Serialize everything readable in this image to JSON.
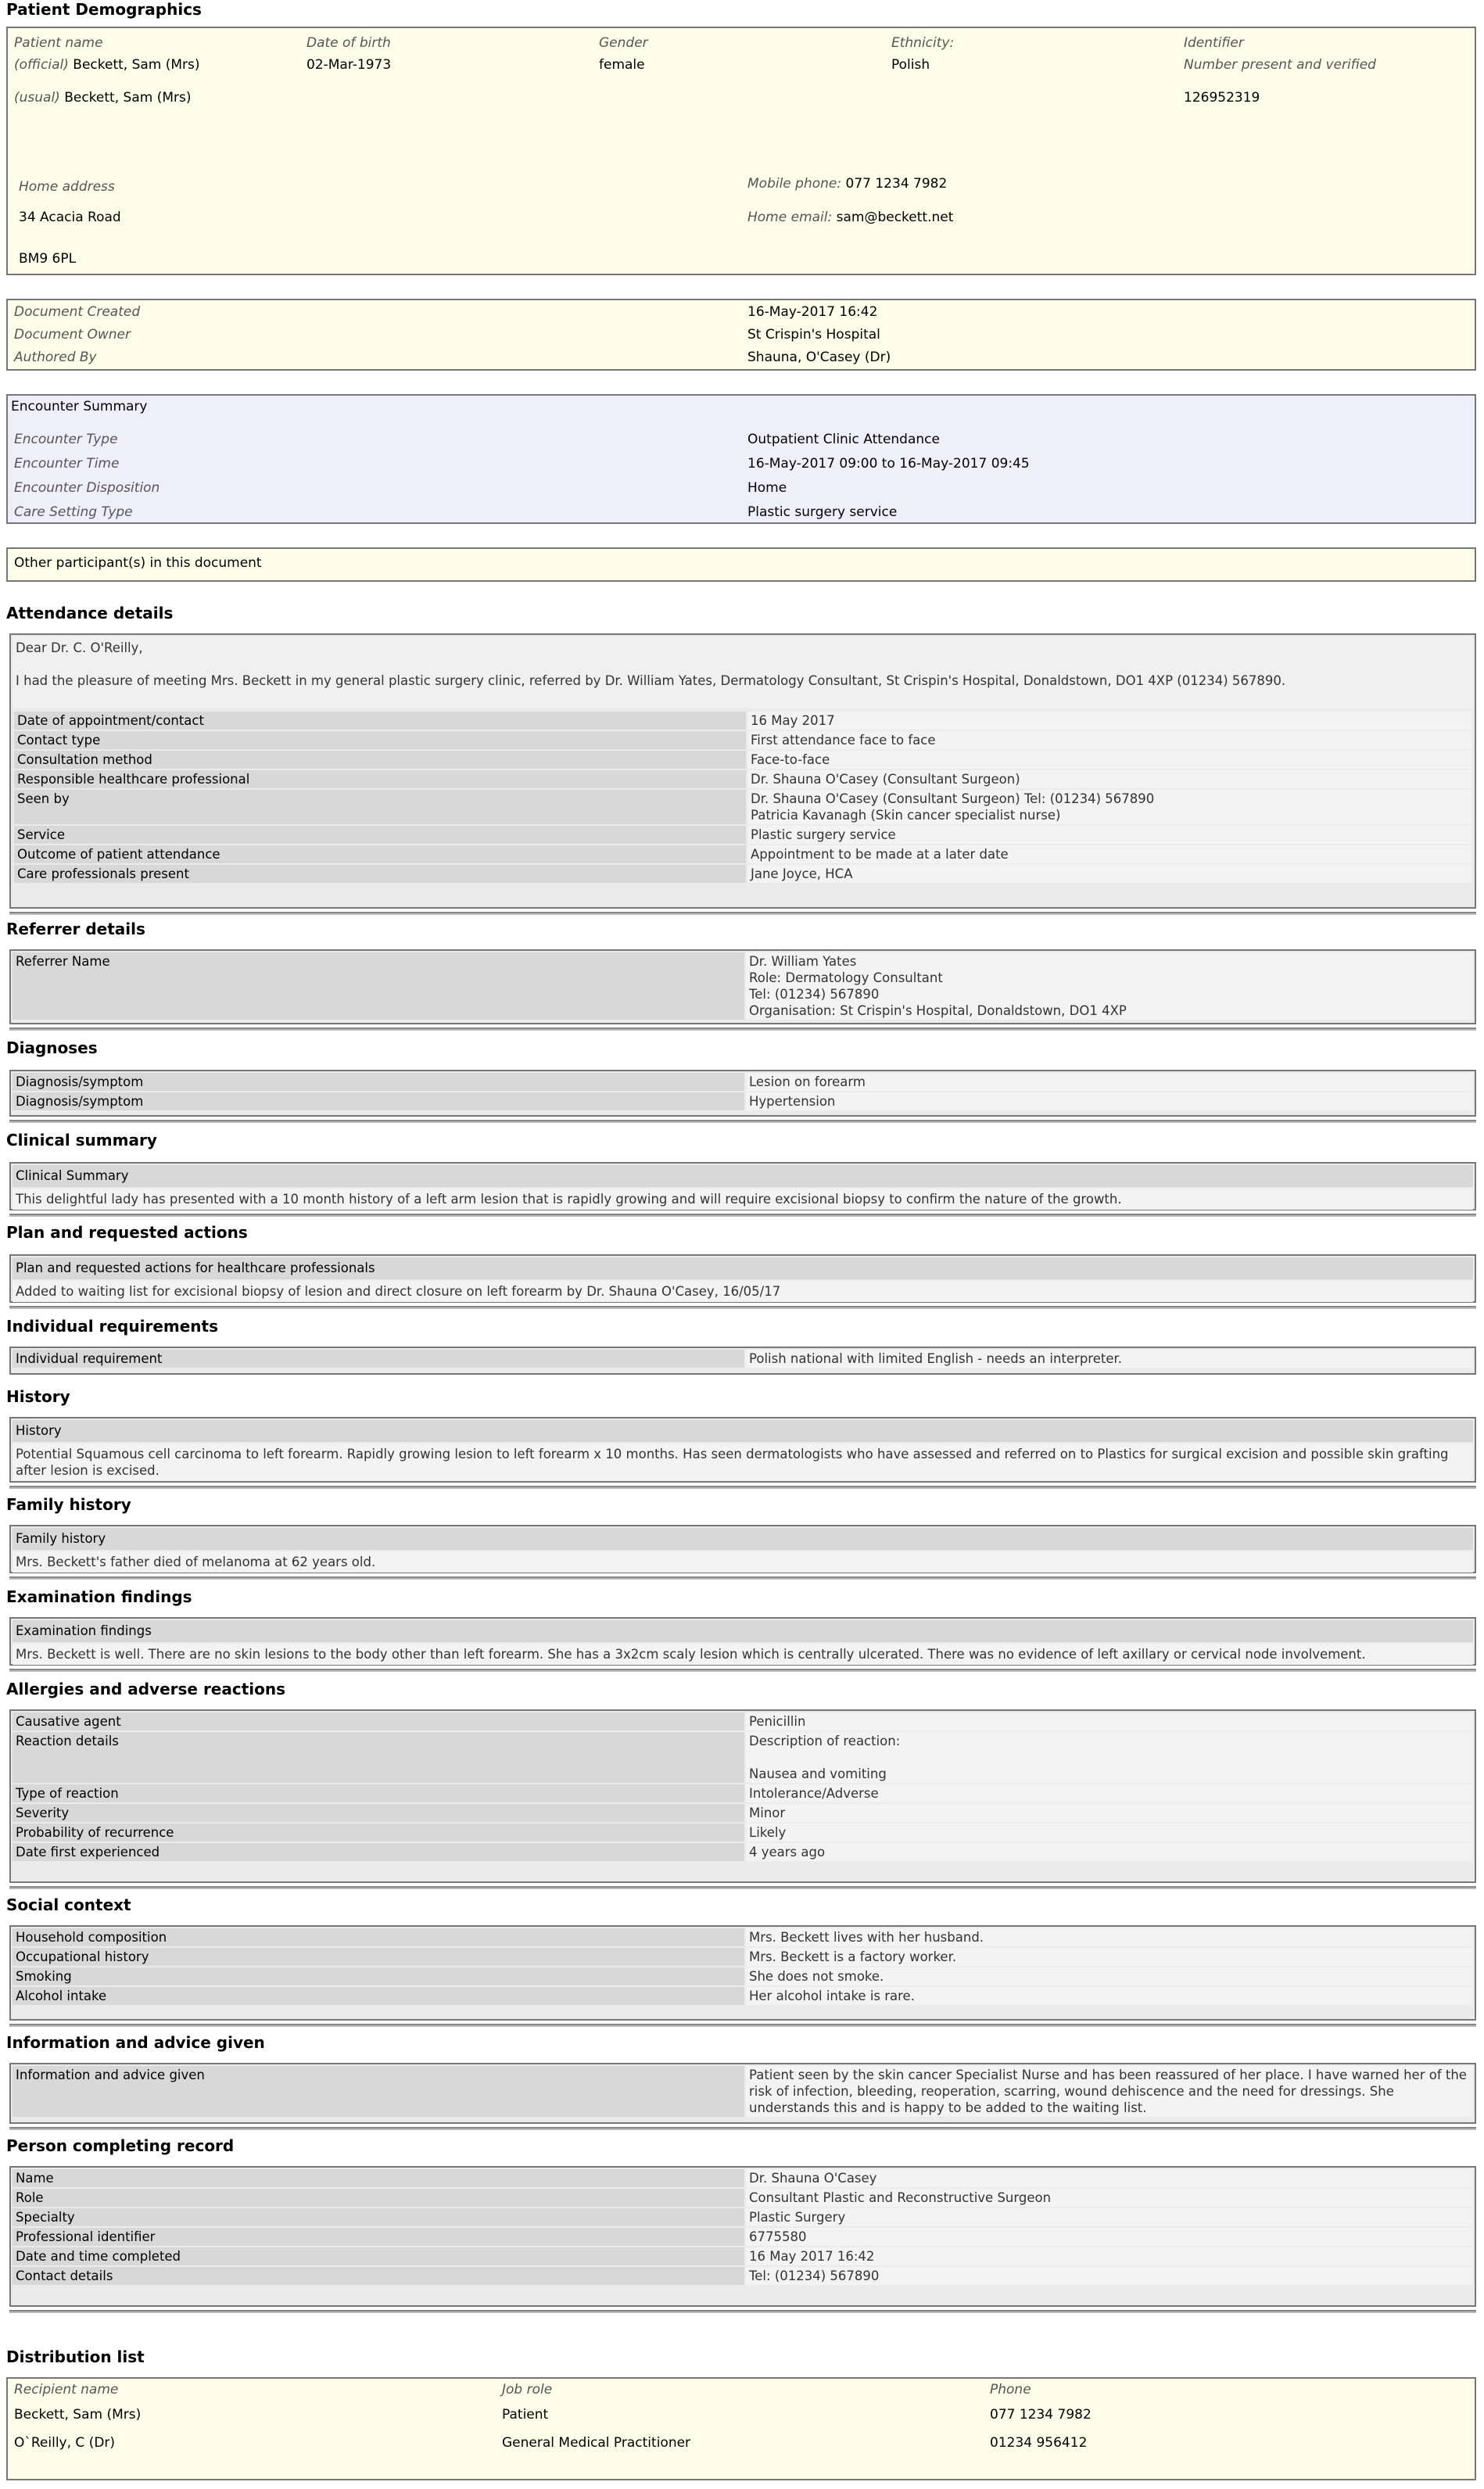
{
  "patient_demographics": {
    "heading": "Patient Demographics",
    "labels": {
      "patient_name": "Patient name",
      "dob": "Date of birth",
      "gender": "Gender",
      "ethnicity": "Ethnicity:",
      "identifier": "Identifier",
      "official": "(official)",
      "usual": "(usual)",
      "home_address": "Home address",
      "mobile": "Mobile phone:",
      "email": "Home email:"
    },
    "official_name": "Beckett, Sam (Mrs)",
    "usual_name": "Beckett, Sam (Mrs)",
    "dob": "02-Mar-1973",
    "gender": "female",
    "ethnicity": "Polish",
    "identifier_status": "Number present and verified",
    "identifier": "126952319",
    "address_line1": "34 Acacia Road",
    "postcode": "BM9 6PL",
    "mobile": "077 1234 7982",
    "email": "sam@beckett.net"
  },
  "document": {
    "created_label": "Document Created",
    "created": "16-May-2017 16:42",
    "owner_label": "Document Owner",
    "owner": "St Crispin's Hospital",
    "author_label": "Authored By",
    "author": "Shauna, O'Casey (Dr)"
  },
  "encounter": {
    "title": "Encounter Summary",
    "type_label": "Encounter Type",
    "type": "Outpatient Clinic Attendance",
    "time_label": "Encounter Time",
    "time": "16-May-2017 09:00 to 16-May-2017 09:45",
    "disposition_label": "Encounter Disposition",
    "disposition": "Home",
    "setting_label": "Care Setting Type",
    "setting": "Plastic surgery service"
  },
  "other_participants": "Other participant(s) in this document",
  "attendance": {
    "heading": "Attendance details",
    "salutation": "Dear Dr. C. O'Reilly,",
    "intro": "I had the pleasure of meeting Mrs. Beckett in my general plastic surgery clinic, referred by Dr. William Yates, Dermatology Consultant, St Crispin's Hospital, Donaldstown, DO1 4XP (01234) 567890.",
    "rows": [
      {
        "k": "Date of appointment/contact",
        "v": "16 May 2017"
      },
      {
        "k": "Contact type",
        "v": "First attendance face to face"
      },
      {
        "k": "Consultation method",
        "v": "Face-to-face"
      },
      {
        "k": "Responsible healthcare professional",
        "v": "Dr. Shauna O'Casey (Consultant Surgeon)"
      },
      {
        "k": "Seen by",
        "v": "Dr. Shauna O'Casey (Consultant Surgeon) Tel: (01234) 567890\nPatricia Kavanagh (Skin cancer specialist nurse)"
      },
      {
        "k": "Service",
        "v": "Plastic surgery service"
      },
      {
        "k": "Outcome of patient attendance",
        "v": "Appointment to be made at a later date"
      },
      {
        "k": "Care professionals present",
        "v": "Jane Joyce, HCA"
      }
    ]
  },
  "referrer": {
    "heading": "Referrer details",
    "rows": [
      {
        "k": "Referrer Name",
        "v": "Dr. William Yates\nRole: Dermatology Consultant\nTel: (01234) 567890\nOrganisation: St Crispin's Hospital, Donaldstown, DO1 4XP"
      }
    ]
  },
  "diagnoses": {
    "heading": "Diagnoses",
    "rows": [
      {
        "k": "Diagnosis/symptom",
        "v": "Lesion on forearm"
      },
      {
        "k": "Diagnosis/symptom",
        "v": "Hypertension"
      }
    ]
  },
  "clinical_summary": {
    "heading": "Clinical summary",
    "label": "Clinical Summary",
    "text": "This delightful lady has presented with a 10 month history of a left arm lesion that is rapidly growing and will require excisional biopsy to confirm the nature of the growth."
  },
  "plan": {
    "heading": "Plan and requested actions",
    "label": "Plan and requested actions for healthcare professionals",
    "text": "Added to waiting list for excisional biopsy of lesion and direct closure on left forearm by Dr. Shauna O'Casey, 16/05/17"
  },
  "individual": {
    "heading": "Individual requirements",
    "rows": [
      {
        "k": "Individual requirement",
        "v": "Polish national with limited English - needs an interpreter."
      }
    ]
  },
  "history": {
    "heading": "History",
    "label": "History",
    "text": "Potential Squamous cell carcinoma to left forearm. Rapidly growing lesion to left forearm x 10 months. Has seen dermatologists who have assessed and referred on to Plastics for surgical excision and possible skin grafting after lesion is excised."
  },
  "family_history": {
    "heading": "Family history",
    "label": "Family history",
    "text": "Mrs. Beckett's father died of melanoma at 62 years old."
  },
  "examination": {
    "heading": "Examination findings",
    "label": "Examination findings",
    "text": "Mrs. Beckett is well. There are no skin lesions to the body other than left forearm. She has a 3x2cm scaly lesion which is centrally ulcerated. There was no evidence of left axillary or cervical node involvement."
  },
  "allergies": {
    "heading": "Allergies and adverse reactions",
    "rows": [
      {
        "k": "Causative agent",
        "v": "Penicillin"
      },
      {
        "k": "Reaction details",
        "v": "Description of reaction:\n\nNausea and vomiting"
      },
      {
        "k": "Type of reaction",
        "v": "Intolerance/Adverse"
      },
      {
        "k": "Severity",
        "v": "Minor"
      },
      {
        "k": "Probability of recurrence",
        "v": "Likely"
      },
      {
        "k": "Date first experienced",
        "v": "4 years ago"
      }
    ]
  },
  "social": {
    "heading": "Social context",
    "rows": [
      {
        "k": "Household composition",
        "v": "Mrs. Beckett lives with her husband."
      },
      {
        "k": "Occupational history",
        "v": "Mrs. Beckett is a factory worker."
      },
      {
        "k": "Smoking",
        "v": "She does not smoke."
      },
      {
        "k": "Alcohol intake",
        "v": "Her alcohol intake is rare."
      }
    ]
  },
  "information": {
    "heading": "Information and advice given",
    "rows": [
      {
        "k": "Information and advice given",
        "v": "Patient seen by the skin cancer Specialist Nurse and has been reassured of her place. I have warned her of the risk of infection, bleeding, reoperation, scarring, wound dehiscence and the need for dressings. She understands this and is happy to be added to the waiting list."
      }
    ]
  },
  "person_completing": {
    "heading": "Person completing record",
    "rows": [
      {
        "k": "Name",
        "v": "Dr. Shauna O'Casey"
      },
      {
        "k": "Role",
        "v": "Consultant Plastic and Reconstructive Surgeon"
      },
      {
        "k": "Specialty",
        "v": "Plastic Surgery"
      },
      {
        "k": "Professional identifier",
        "v": "6775580"
      },
      {
        "k": "Date and time completed",
        "v": "16 May 2017 16:42"
      },
      {
        "k": "Contact details",
        "v": "Tel: (01234) 567890"
      }
    ]
  },
  "distribution": {
    "heading": "Distribution list",
    "col_recipient": "Recipient name",
    "col_role": "Job role",
    "col_phone": "Phone",
    "rows": [
      {
        "name": "Beckett, Sam (Mrs)",
        "role": "Patient",
        "phone": "077 1234 7982"
      },
      {
        "name": "O`Reilly, C (Dr)",
        "role": "General Medical Practitioner",
        "phone": "01234 956412"
      }
    ]
  }
}
